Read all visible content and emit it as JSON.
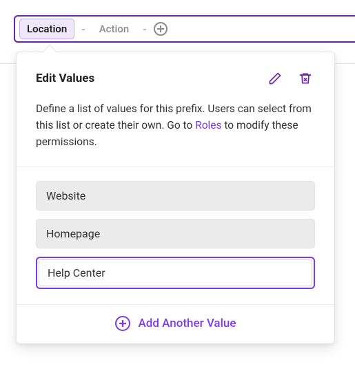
{
  "rail": {
    "active_chip": "Location",
    "placeholder_chip": "Action"
  },
  "popover": {
    "title": "Edit Values",
    "desc_pre": "Define a list of values for this prefix. Users can select from this list or create their own. Go to ",
    "roles_link": "Roles",
    "desc_post": " to modify these permissions.",
    "values": [
      "Website",
      "Homepage"
    ],
    "editing_value": "Help Center",
    "add_label": "Add Another Value"
  },
  "colors": {
    "accent": "#7c3aed"
  }
}
